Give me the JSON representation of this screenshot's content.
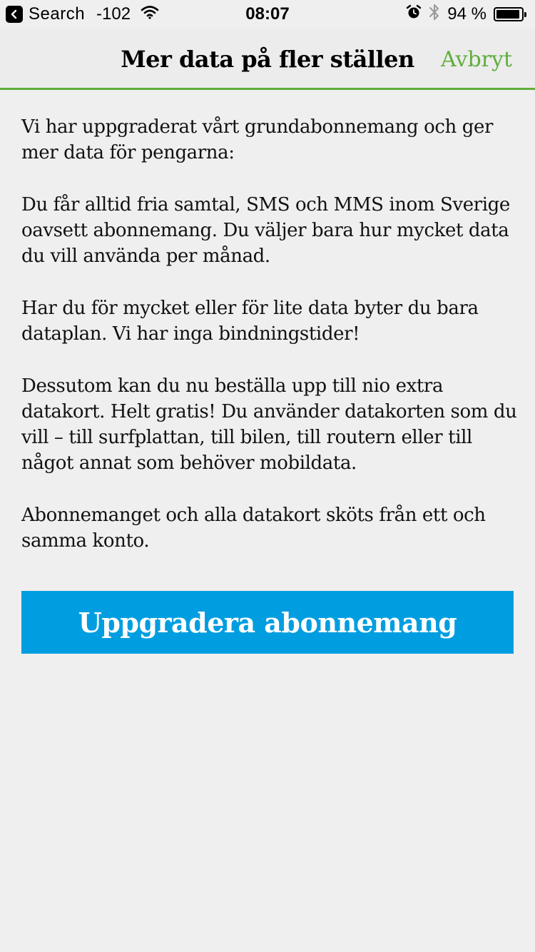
{
  "status_bar": {
    "back_app_label": "Search",
    "signal_text": "-102",
    "time": "08:07",
    "battery_percent_text": "94 %",
    "battery_level": 0.94
  },
  "nav": {
    "title": "Mer data på fler ställen",
    "cancel_label": "Avbryt",
    "accent_color": "#5fae3c"
  },
  "content": {
    "paragraphs": [
      "Vi har uppgraderat vårt grundabonnemang och ger mer data för pengarna:",
      "Du får alltid fria samtal, SMS och MMS inom Sverige oavsett abonnemang. Du väljer bara hur mycket data du vill använda per månad.",
      "Har du för mycket eller för lite data byter du bara dataplan. Vi har inga bindningstider!",
      "Dessutom kan du nu beställa upp till nio extra datakort. Helt gratis! Du använder datakorten som du vill – till surfplattan, till bilen, till routern eller till något annat som behöver mobildata.",
      "Abonnemanget och alla datakort sköts från ett och samma konto."
    ]
  },
  "cta": {
    "label": "Uppgradera abonnemang",
    "color": "#009ee0"
  },
  "icons": {
    "back": "chevron-left-icon",
    "wifi": "wifi-icon",
    "alarm": "alarm-clock-icon",
    "bluetooth": "bluetooth-icon",
    "battery": "battery-icon"
  }
}
